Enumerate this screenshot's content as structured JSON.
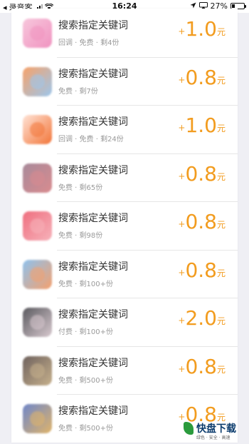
{
  "status_bar": {
    "carrier": "录音客",
    "time": "16:24",
    "battery": "27%",
    "battery_level": 0.27
  },
  "list": {
    "items": [
      {
        "title": "搜索指定关键词",
        "meta": "回调 · 免费 · 剩4份",
        "plus": "+",
        "amount": "1.0",
        "unit": "元",
        "thumb_colors": [
          "#f7c7dc",
          "#f093c0"
        ]
      },
      {
        "title": "搜索指定关键词",
        "meta": "免费 · 剩7份",
        "plus": "+",
        "amount": "0.8",
        "unit": "元",
        "thumb_colors": [
          "#f7a26a",
          "#9cc6ec"
        ]
      },
      {
        "title": "搜索指定关键词",
        "meta": "回调 · 免费 · 剩24份",
        "plus": "+",
        "amount": "1.0",
        "unit": "元",
        "thumb_colors": [
          "#ffe3d6",
          "#f2763a"
        ]
      },
      {
        "title": "搜索指定关键词",
        "meta": "免费 · 剩65份",
        "plus": "+",
        "amount": "0.8",
        "unit": "元",
        "thumb_colors": [
          "#a88a9a",
          "#d98b8f"
        ]
      },
      {
        "title": "搜索指定关键词",
        "meta": "免费 · 剩98份",
        "plus": "+",
        "amount": "0.8",
        "unit": "元",
        "thumb_colors": [
          "#ef6f7f",
          "#f6b2ba"
        ]
      },
      {
        "title": "搜索指定关键词",
        "meta": "免费 · 剩100+份",
        "plus": "+",
        "amount": "0.8",
        "unit": "元",
        "thumb_colors": [
          "#8ec2ee",
          "#f4a06e"
        ]
      },
      {
        "title": "搜索指定关键词",
        "meta": "付费 · 剩100+份",
        "plus": "+",
        "amount": "2.0",
        "unit": "元",
        "thumb_colors": [
          "#5a5a5f",
          "#d8c9cf"
        ]
      },
      {
        "title": "搜索指定关键词",
        "meta": "免费 · 剩500+份",
        "plus": "+",
        "amount": "0.8",
        "unit": "元",
        "thumb_colors": [
          "#6f625e",
          "#c6b08c"
        ]
      },
      {
        "title": "搜索指定关键词",
        "meta": "免费 · 剩500+份",
        "plus": "+",
        "amount": "0.8",
        "unit": "元",
        "thumb_colors": [
          "#6e86c9",
          "#e0b46a"
        ]
      }
    ]
  },
  "watermark": {
    "name": "快盘下载",
    "tagline": "绿色 · 安全 · 高速"
  },
  "colors": {
    "price": "#f29c1f",
    "title": "#333333",
    "meta": "#9a9a9a",
    "background": "#efeff4"
  }
}
